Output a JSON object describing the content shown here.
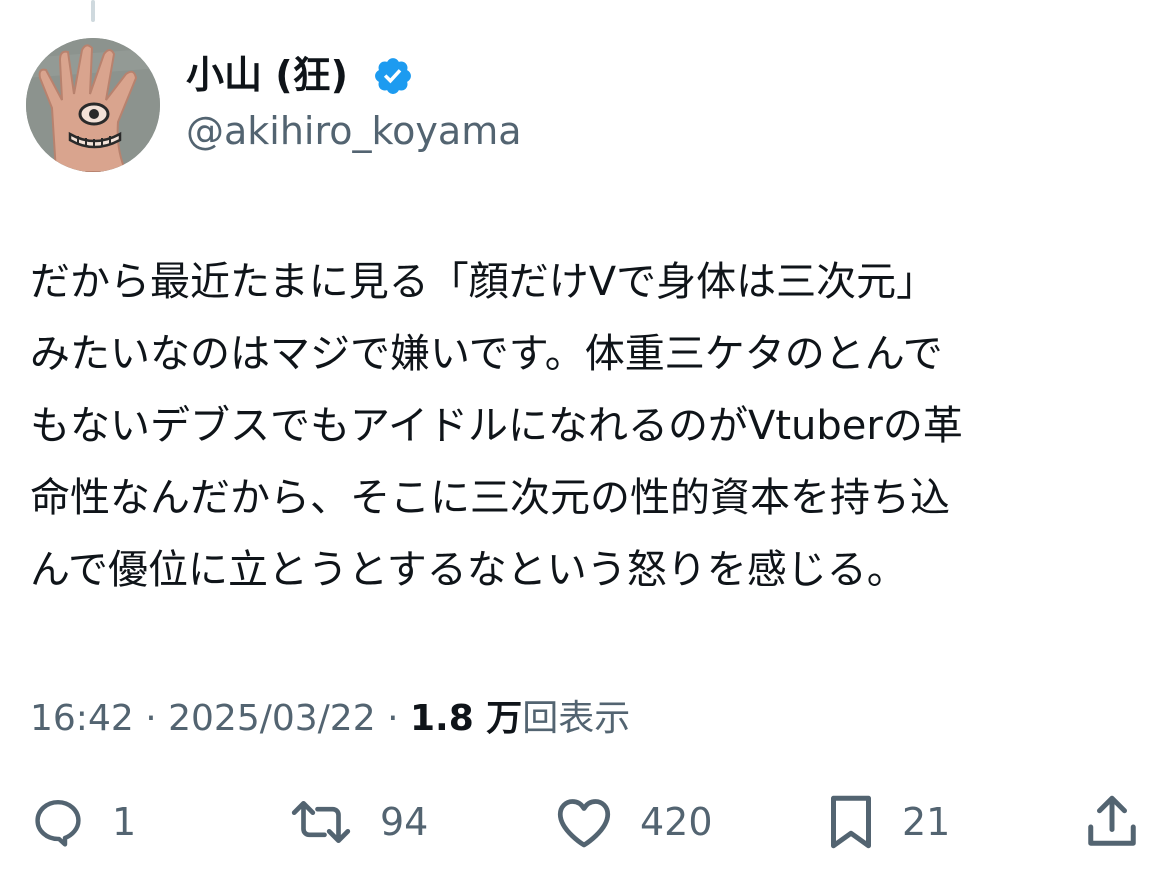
{
  "author": {
    "display_name": "小山 (狂)",
    "handle": "@akihiro_koyama",
    "verified": true,
    "avatar_icon": "hand-eye-drawing-avatar"
  },
  "tweet": {
    "lines": [
      "だから最近たまに見る「顔だけVで身体は三次元」",
      "みたいなのはマジで嫌いです。体重三ケタのとんで",
      "もないデブスでもアイドルになれるのがVtuberの革",
      "命性なんだから、そこに三次元の性的資本を持ち込",
      "んで優位に立とうとするなという怒りを感じる。"
    ]
  },
  "meta": {
    "time": "16:42",
    "date": "2025/03/22",
    "views_count": "1.8 万",
    "views_label": "回表示",
    "separator": "·"
  },
  "actions": {
    "reply": {
      "icon": "reply-icon",
      "count": "1"
    },
    "retweet": {
      "icon": "retweet-icon",
      "count": "94"
    },
    "like": {
      "icon": "heart-icon",
      "count": "420"
    },
    "bookmark": {
      "icon": "bookmark-icon",
      "count": "21"
    },
    "share": {
      "icon": "share-icon"
    }
  },
  "colors": {
    "text_primary": "#0f1419",
    "text_secondary": "#536471",
    "verified_blue": "#1d9bf0"
  }
}
